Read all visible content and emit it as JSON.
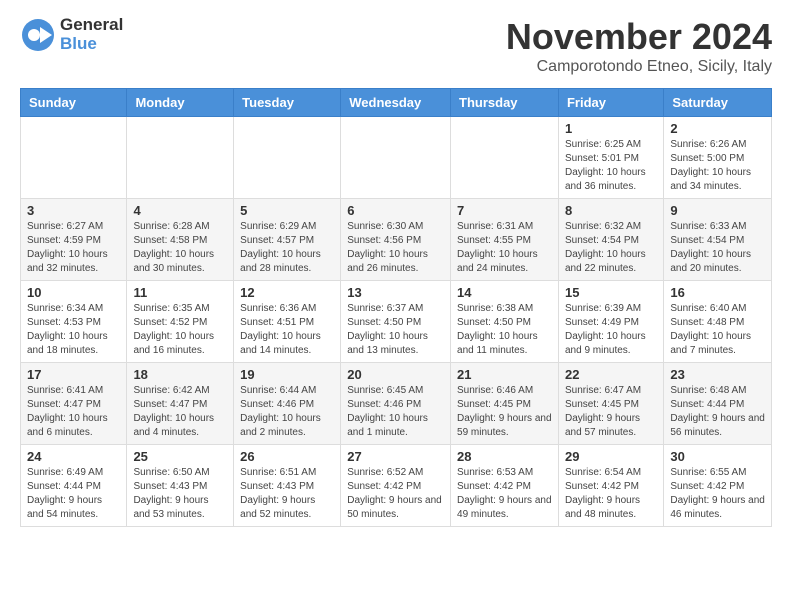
{
  "header": {
    "logo": {
      "general": "General",
      "blue": "Blue"
    },
    "title": "November 2024",
    "subtitle": "Camporotondo Etneo, Sicily, Italy"
  },
  "weekdays": [
    "Sunday",
    "Monday",
    "Tuesday",
    "Wednesday",
    "Thursday",
    "Friday",
    "Saturday"
  ],
  "weeks": [
    [
      {
        "day": "",
        "info": ""
      },
      {
        "day": "",
        "info": ""
      },
      {
        "day": "",
        "info": ""
      },
      {
        "day": "",
        "info": ""
      },
      {
        "day": "",
        "info": ""
      },
      {
        "day": "1",
        "info": "Sunrise: 6:25 AM\nSunset: 5:01 PM\nDaylight: 10 hours and 36 minutes."
      },
      {
        "day": "2",
        "info": "Sunrise: 6:26 AM\nSunset: 5:00 PM\nDaylight: 10 hours and 34 minutes."
      }
    ],
    [
      {
        "day": "3",
        "info": "Sunrise: 6:27 AM\nSunset: 4:59 PM\nDaylight: 10 hours and 32 minutes."
      },
      {
        "day": "4",
        "info": "Sunrise: 6:28 AM\nSunset: 4:58 PM\nDaylight: 10 hours and 30 minutes."
      },
      {
        "day": "5",
        "info": "Sunrise: 6:29 AM\nSunset: 4:57 PM\nDaylight: 10 hours and 28 minutes."
      },
      {
        "day": "6",
        "info": "Sunrise: 6:30 AM\nSunset: 4:56 PM\nDaylight: 10 hours and 26 minutes."
      },
      {
        "day": "7",
        "info": "Sunrise: 6:31 AM\nSunset: 4:55 PM\nDaylight: 10 hours and 24 minutes."
      },
      {
        "day": "8",
        "info": "Sunrise: 6:32 AM\nSunset: 4:54 PM\nDaylight: 10 hours and 22 minutes."
      },
      {
        "day": "9",
        "info": "Sunrise: 6:33 AM\nSunset: 4:54 PM\nDaylight: 10 hours and 20 minutes."
      }
    ],
    [
      {
        "day": "10",
        "info": "Sunrise: 6:34 AM\nSunset: 4:53 PM\nDaylight: 10 hours and 18 minutes."
      },
      {
        "day": "11",
        "info": "Sunrise: 6:35 AM\nSunset: 4:52 PM\nDaylight: 10 hours and 16 minutes."
      },
      {
        "day": "12",
        "info": "Sunrise: 6:36 AM\nSunset: 4:51 PM\nDaylight: 10 hours and 14 minutes."
      },
      {
        "day": "13",
        "info": "Sunrise: 6:37 AM\nSunset: 4:50 PM\nDaylight: 10 hours and 13 minutes."
      },
      {
        "day": "14",
        "info": "Sunrise: 6:38 AM\nSunset: 4:50 PM\nDaylight: 10 hours and 11 minutes."
      },
      {
        "day": "15",
        "info": "Sunrise: 6:39 AM\nSunset: 4:49 PM\nDaylight: 10 hours and 9 minutes."
      },
      {
        "day": "16",
        "info": "Sunrise: 6:40 AM\nSunset: 4:48 PM\nDaylight: 10 hours and 7 minutes."
      }
    ],
    [
      {
        "day": "17",
        "info": "Sunrise: 6:41 AM\nSunset: 4:47 PM\nDaylight: 10 hours and 6 minutes."
      },
      {
        "day": "18",
        "info": "Sunrise: 6:42 AM\nSunset: 4:47 PM\nDaylight: 10 hours and 4 minutes."
      },
      {
        "day": "19",
        "info": "Sunrise: 6:44 AM\nSunset: 4:46 PM\nDaylight: 10 hours and 2 minutes."
      },
      {
        "day": "20",
        "info": "Sunrise: 6:45 AM\nSunset: 4:46 PM\nDaylight: 10 hours and 1 minute."
      },
      {
        "day": "21",
        "info": "Sunrise: 6:46 AM\nSunset: 4:45 PM\nDaylight: 9 hours and 59 minutes."
      },
      {
        "day": "22",
        "info": "Sunrise: 6:47 AM\nSunset: 4:45 PM\nDaylight: 9 hours and 57 minutes."
      },
      {
        "day": "23",
        "info": "Sunrise: 6:48 AM\nSunset: 4:44 PM\nDaylight: 9 hours and 56 minutes."
      }
    ],
    [
      {
        "day": "24",
        "info": "Sunrise: 6:49 AM\nSunset: 4:44 PM\nDaylight: 9 hours and 54 minutes."
      },
      {
        "day": "25",
        "info": "Sunrise: 6:50 AM\nSunset: 4:43 PM\nDaylight: 9 hours and 53 minutes."
      },
      {
        "day": "26",
        "info": "Sunrise: 6:51 AM\nSunset: 4:43 PM\nDaylight: 9 hours and 52 minutes."
      },
      {
        "day": "27",
        "info": "Sunrise: 6:52 AM\nSunset: 4:42 PM\nDaylight: 9 hours and 50 minutes."
      },
      {
        "day": "28",
        "info": "Sunrise: 6:53 AM\nSunset: 4:42 PM\nDaylight: 9 hours and 49 minutes."
      },
      {
        "day": "29",
        "info": "Sunrise: 6:54 AM\nSunset: 4:42 PM\nDaylight: 9 hours and 48 minutes."
      },
      {
        "day": "30",
        "info": "Sunrise: 6:55 AM\nSunset: 4:42 PM\nDaylight: 9 hours and 46 minutes."
      }
    ]
  ]
}
